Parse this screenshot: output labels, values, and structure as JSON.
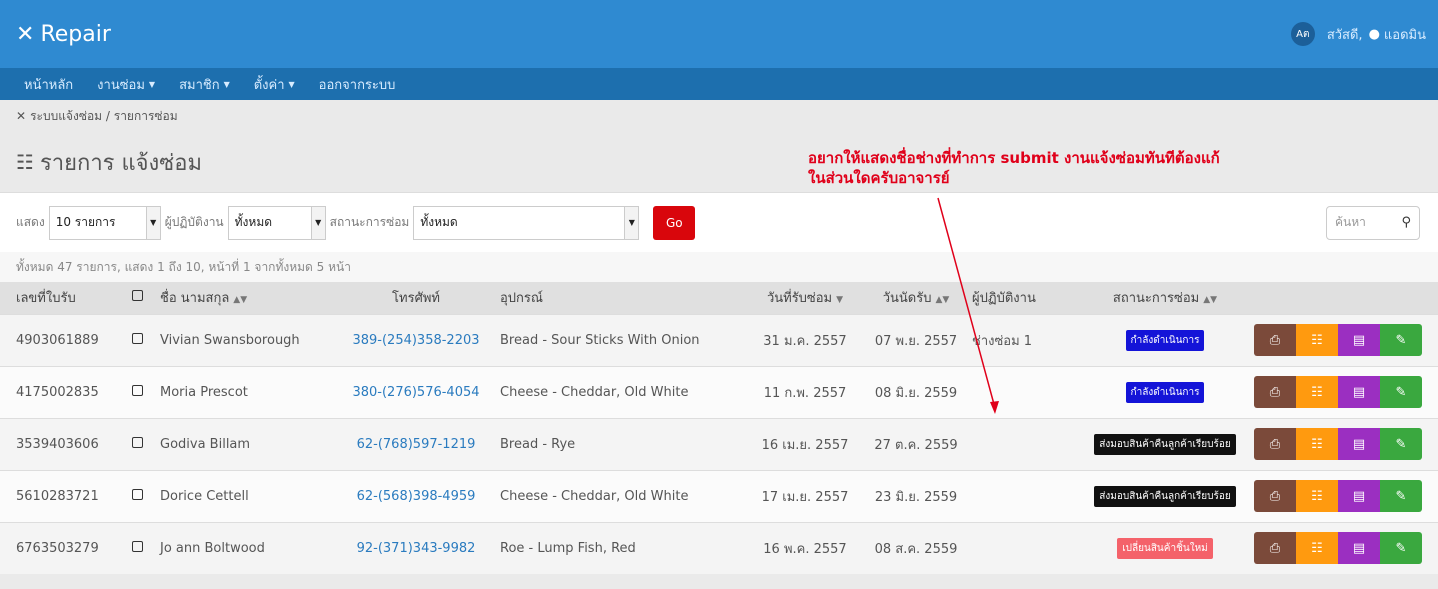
{
  "app": {
    "title": "Repair"
  },
  "topbar": {
    "lang": "Aต",
    "greeting": "สวัสดี,",
    "user": "แอดมิน"
  },
  "nav": [
    {
      "label": "หน้าหลัก",
      "caret": false
    },
    {
      "label": "งานซ่อม",
      "caret": true
    },
    {
      "label": "สมาชิก",
      "caret": true
    },
    {
      "label": "ตั้งค่า",
      "caret": true
    },
    {
      "label": "ออกจากระบบ",
      "caret": false
    }
  ],
  "breadcrumb": "ระบบแจ้งซ่อม / รายการซ่อม",
  "page_title": "รายการ แจ้งซ่อม",
  "question": [
    "อยากให้แสดงชื่อช่างที่ทำการ submit  งานแจ้งซ่อมทันทีต้องแก้",
    "ในส่วนใดครับอาจารย์"
  ],
  "filters": {
    "show_label": "แสดง",
    "show_value": "10 รายการ",
    "operator_label": "ผู้ปฏิบัติงาน",
    "operator_value": "ทั้งหมด",
    "status_label": "สถานะการซ่อม",
    "status_value": "ทั้งหมด",
    "go_label": "Go",
    "search_placeholder": "ค้นหา"
  },
  "summary": "ทั้งหมด 47 รายการ, แสดง 1 ถึง 10, หน้าที่ 1 จากทั้งหมด 5 หน้า",
  "columns": {
    "id": "เลขที่ใบรับ",
    "name": "ชื่อ นามสกุล",
    "phone": "โทรศัพท์",
    "device": "อุปกรณ์",
    "received": "วันที่รับซ่อม",
    "due": "วันนัดรับ",
    "operator": "ผู้ปฏิบัติงาน",
    "status": "สถานะการซ่อม"
  },
  "rows": [
    {
      "id": "4903061889",
      "name": "Vivian Swansborough",
      "phone": "389-(254)358-2203",
      "device": "Bread - Sour Sticks With Onion",
      "received": "31 ม.ค. 2557",
      "due": "07 พ.ย. 2557",
      "operator": "ช่างซ่อม 1",
      "status": "กำลังดำเนินการ",
      "status_color": "#1414d8"
    },
    {
      "id": "4175002835",
      "name": "Moria Prescot",
      "phone": "380-(276)576-4054",
      "device": "Cheese - Cheddar, Old White",
      "received": "11 ก.พ. 2557",
      "due": "08 มิ.ย. 2559",
      "operator": "",
      "status": "กำลังดำเนินการ",
      "status_color": "#1414d8"
    },
    {
      "id": "3539403606",
      "name": "Godiva Billam",
      "phone": "62-(768)597-1219",
      "device": "Bread - Rye",
      "received": "16 เม.ย. 2557",
      "due": "27 ต.ค. 2559",
      "operator": "",
      "status": "ส่งมอบสินค้าคืนลูกค้าเรียบร้อย",
      "status_color": "#111111"
    },
    {
      "id": "5610283721",
      "name": "Dorice Cettell",
      "phone": "62-(568)398-4959",
      "device": "Cheese - Cheddar, Old White",
      "received": "17 เม.ย. 2557",
      "due": "23 มิ.ย. 2559",
      "operator": "",
      "status": "ส่งมอบสินค้าคืนลูกค้าเรียบร้อย",
      "status_color": "#111111"
    },
    {
      "id": "6763503279",
      "name": "Jo ann Boltwood",
      "phone": "92-(371)343-9982",
      "device": "Roe - Lump Fish, Red",
      "received": "16 พ.ค. 2557",
      "due": "08 ส.ค. 2559",
      "operator": "",
      "status": "เปลี่ยนสินค้าชิ้นใหม่",
      "status_color": "#f4626a"
    }
  ],
  "icons": {
    "brand": "wrench-icon",
    "print": "print-icon",
    "task": "task-list-icon",
    "detail": "detail-icon",
    "edit": "pencil-icon"
  },
  "colors": {
    "topbar": "#2f8ad1",
    "navbar": "#1d6fae",
    "go": "#d9060c",
    "annotation": "#e0001a"
  }
}
